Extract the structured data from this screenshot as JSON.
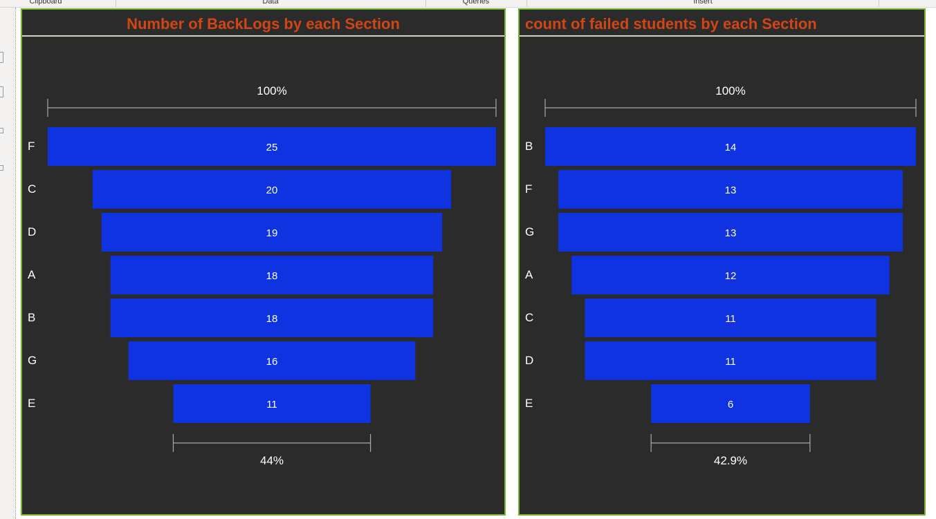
{
  "ribbon": {
    "groups": [
      "Clipboard",
      "Data",
      "Queries",
      "Insert"
    ]
  },
  "colors": {
    "card_background": "#2b2b2b",
    "card_border": "#76b52e",
    "title": "#d24515",
    "bar": "#0f33e0",
    "bracket": "#aaaaaa"
  },
  "chart_data": [
    {
      "type": "bar",
      "orientation": "funnel",
      "title": "Number of BackLogs by each Section",
      "categories": [
        "F",
        "C",
        "D",
        "A",
        "B",
        "G",
        "E"
      ],
      "values": [
        25,
        20,
        19,
        18,
        18,
        16,
        11
      ],
      "top_percent_label": "100%",
      "bottom_percent_label": "44%",
      "xlabel": "",
      "ylabel": ""
    },
    {
      "type": "bar",
      "orientation": "funnel",
      "title": "count of failed students by each Section",
      "categories": [
        "B",
        "F",
        "G",
        "A",
        "C",
        "D",
        "E"
      ],
      "values": [
        14,
        13,
        13,
        12,
        11,
        11,
        6
      ],
      "top_percent_label": "100%",
      "bottom_percent_label": "42.9%",
      "xlabel": "",
      "ylabel": ""
    }
  ]
}
